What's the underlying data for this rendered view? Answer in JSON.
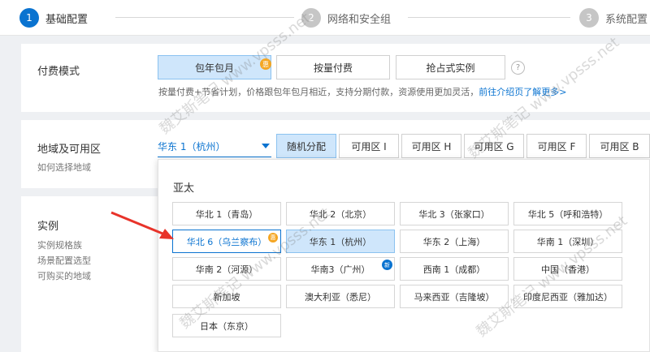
{
  "steps": [
    {
      "num": "1",
      "label": "基础配置"
    },
    {
      "num": "2",
      "label": "网络和安全组"
    },
    {
      "num": "3",
      "label": "系统配置"
    }
  ],
  "billing": {
    "label": "付费模式",
    "options": [
      "包年包月",
      "按量付费",
      "抢占式实例"
    ],
    "selected_badge": "惠",
    "help": "?",
    "description": "按量付费+节省计划，价格跟包年包月相近，支持分期付款，资源使用更加灵活，",
    "description_link": "前往介绍页了解更多>"
  },
  "region": {
    "label": "地域及可用区",
    "sublabel": "如何选择地域",
    "selected": "华东 1（杭州）",
    "zones": [
      "随机分配",
      "可用区 I",
      "可用区 H",
      "可用区 G",
      "可用区 F",
      "可用区 B"
    ]
  },
  "instance": {
    "label": "实例",
    "links": [
      "实例规格族",
      "场景配置选型",
      "可购买的地域"
    ]
  },
  "dropdown": {
    "group": "亚太",
    "options": [
      "华北 1（青岛）",
      "华北 2（北京）",
      "华北 3（张家口）",
      "华北 5（呼和浩特）",
      "华北 6（乌兰察布）",
      "华东 1（杭州）",
      "华东 2（上海）",
      "华南 1（深圳）",
      "华南 2（河源）",
      "华南3（广州）",
      "西南 1（成都）",
      "中国（香港）",
      "新加坡",
      "澳大利亚（悉尼）",
      "马来西亚（吉隆坡）",
      "印度尼西亚（雅加达）",
      "日本（东京）"
    ],
    "tag_hui": "惠",
    "tag_new": "新"
  },
  "watermark": "魏艾斯笔记 www.vpsss.net",
  "colors": {
    "accent": "#0a73d0",
    "selected_bg": "#cfe6fb",
    "arrow": "#e8332a",
    "badge": "#f5a623"
  }
}
